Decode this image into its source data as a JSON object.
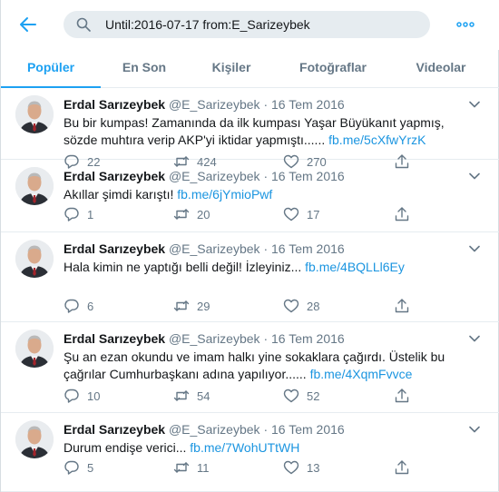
{
  "search": {
    "query": "Until:2016-07-17 from:E_Sarizeybek"
  },
  "tabs": [
    "Popüler",
    "En Son",
    "Kişiler",
    "Fotoğraflar",
    "Videolar"
  ],
  "author": {
    "name": "Erdal Sarızeybek",
    "handle": "@E_Sarizeybek",
    "separator": "·"
  },
  "colors": {
    "accent": "#1da1f2",
    "link": "#1b95e0",
    "muted": "#657786",
    "search_bg": "#e6ecf0"
  },
  "icons": [
    "back-arrow-icon",
    "search-icon",
    "more-icon",
    "chevron-down-icon",
    "reply-icon",
    "retweet-icon",
    "like-icon",
    "share-icon"
  ],
  "tweets": [
    {
      "date": "16 Tem 2016",
      "text": "Bu bir kumpas! Zamanında da ilk kumpası Yaşar Büyükanıt yapmış, sözde muhtıra verip AKP'yi iktidar yapmıştı...... ",
      "link": "fb.me/5cXfwYrzK",
      "replies": "22",
      "retweets": "424",
      "likes": "270"
    },
    {
      "date": "16 Tem 2016",
      "text": "Akıllar şimdi karıştı! ",
      "link": "fb.me/6jYmioPwf",
      "replies": "1",
      "retweets": "20",
      "likes": "17"
    },
    {
      "date": "16 Tem 2016",
      "text": "Hala kimin ne yaptığı belli değil! İzleyiniz... ",
      "link": "fb.me/4BQLLl6Ey",
      "replies": "6",
      "retweets": "29",
      "likes": "28"
    },
    {
      "date": "16 Tem 2016",
      "text": "Şu an ezan okundu ve imam halkı yine sokaklara çağırdı. Üstelik bu çağrılar Cumhurbaşkanı adına yapılıyor...... ",
      "link": "fb.me/4XqmFvvce",
      "replies": "10",
      "retweets": "54",
      "likes": "52"
    },
    {
      "date": "16 Tem 2016",
      "text": "Durum endişe verici... ",
      "link": "fb.me/7WohUTtWH",
      "replies": "5",
      "retweets": "11",
      "likes": "13"
    }
  ]
}
